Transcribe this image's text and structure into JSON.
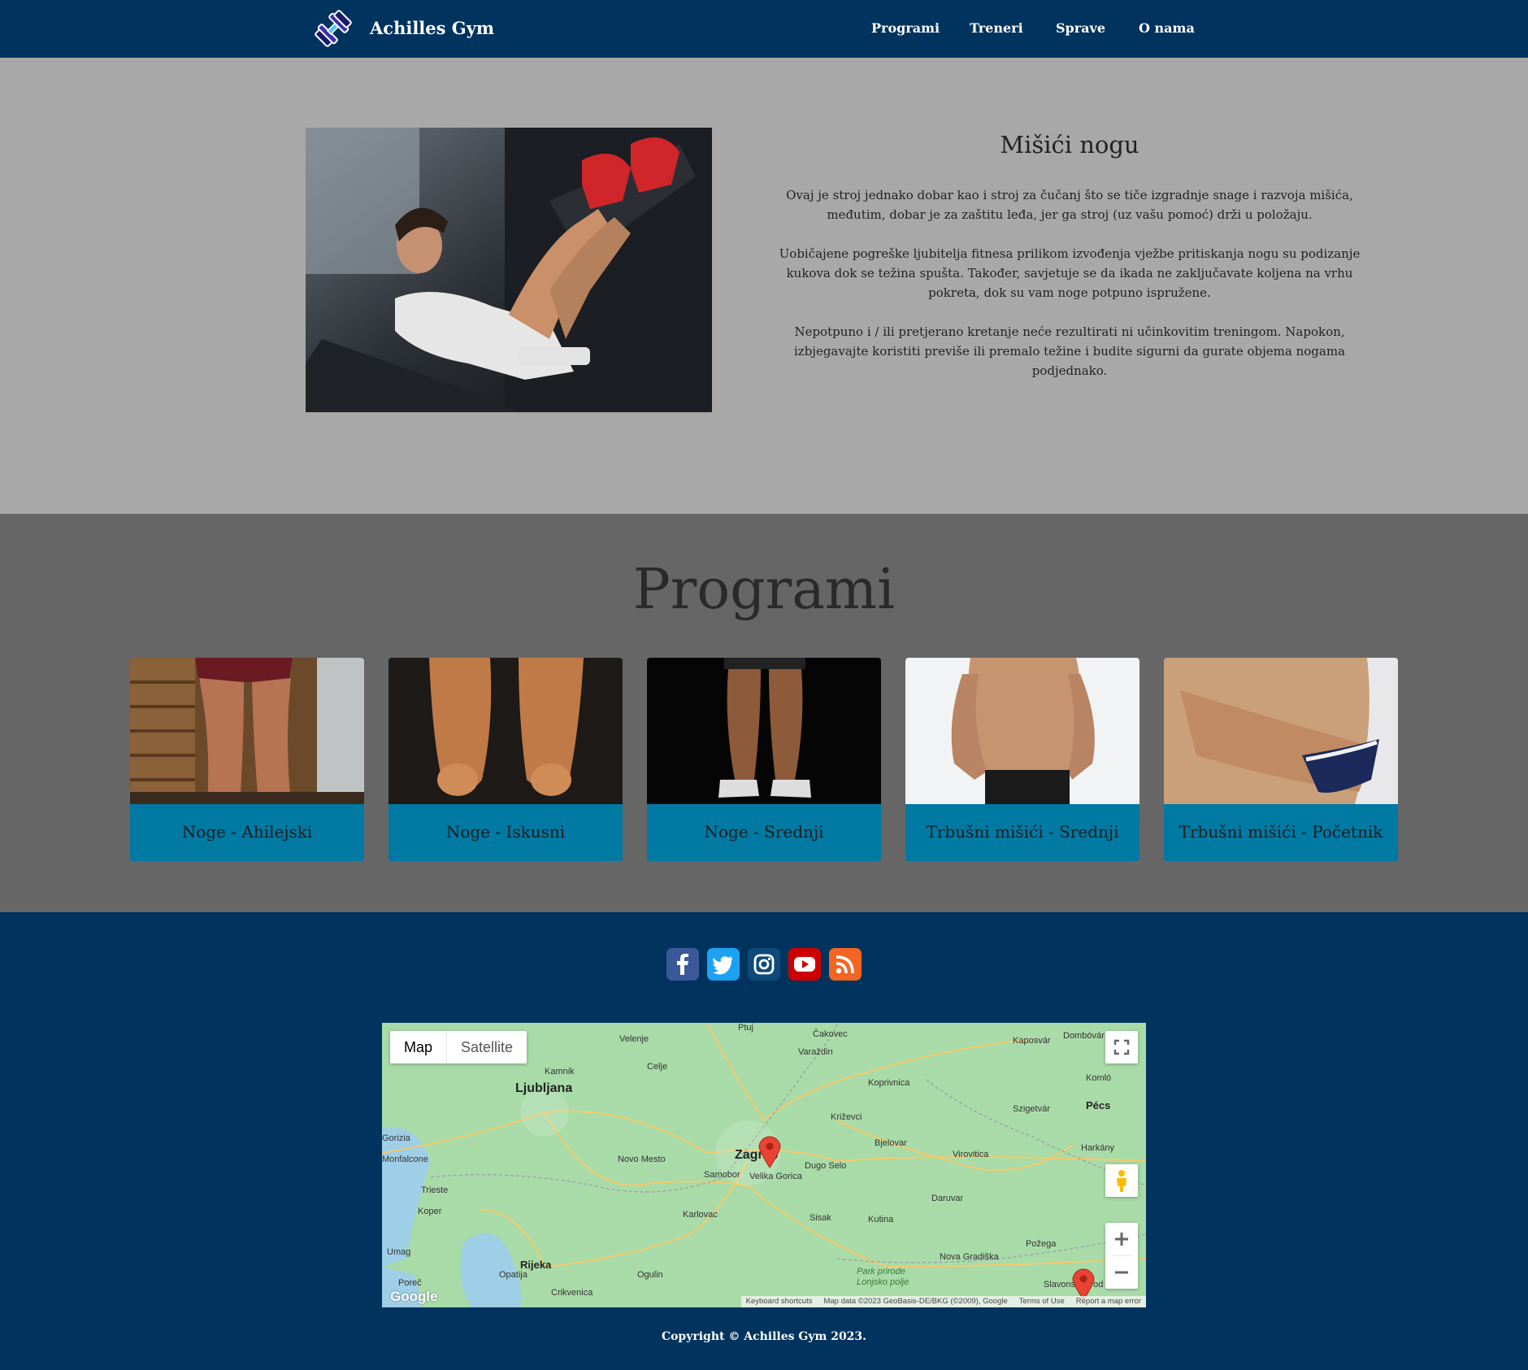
{
  "navbar": {
    "brand": "Achilles Gym",
    "links": [
      "Programi",
      "Treneri",
      "Sprave",
      "O nama"
    ]
  },
  "hero": {
    "title": "Mišići nogu",
    "paragraphs": [
      "Ovaj je stroj jednako dobar kao i stroj za čučanj što se tiče izgradnje snage i razvoja mišića, međutim, dobar je za zaštitu leđa, jer ga stroj (uz vašu pomoć) drži u položaju.",
      "Uobičajene pogreške ljubitelja fitnesa prilikom izvođenja vježbe pritiskanja nogu su podizanje kukova dok se težina spušta. Također, savjetuje se da ikada ne zaključavate koljena na vrhu pokreta, dok su vam noge potpuno ispružene.",
      "Nepotpuno i / ili pretjerano kretanje neće rezultirati ni učinkovitim treningom. Napokon, izbjegavajte koristiti previše ili premalo težine i budite sigurni da gurate objema nogama podjednako."
    ]
  },
  "programs": {
    "title": "Programi",
    "cards": [
      {
        "label": "Noge - Ahilejski"
      },
      {
        "label": "Noge - Iskusni"
      },
      {
        "label": "Noge - Srednji"
      },
      {
        "label": "Trbušni mišići - Srednji"
      },
      {
        "label": "Trbušni mišići - Početnik"
      }
    ]
  },
  "footer": {
    "social": [
      {
        "icon": "facebook-icon",
        "color": "#3b5998"
      },
      {
        "icon": "twitter-icon",
        "color": "#1da1f2"
      },
      {
        "icon": "instagram-icon",
        "color": "#0d4a7a"
      },
      {
        "icon": "youtube-icon",
        "color": "#cc0000"
      },
      {
        "icon": "rss-icon",
        "color": "#f26522"
      }
    ],
    "map": {
      "type_map": "Map",
      "type_satellite": "Satellite",
      "attribution": [
        "Keyboard shortcuts",
        "Map data ©2023 GeoBasis-DE/BKG (©2009), Google",
        "Terms of Use",
        "Report a map error"
      ],
      "logo": "Google",
      "labels": [
        "Ljubljana",
        "Zagreb",
        "Rijeka",
        "Trieste",
        "Koper",
        "Novo Mesto",
        "Samobor",
        "Velika Gorica",
        "Dugo Selo",
        "Karlovac",
        "Sisak",
        "Kutina",
        "Bjelovar",
        "Križevci",
        "Koprivnica",
        "Varaždin",
        "Čakovec",
        "Celje",
        "Kamnik",
        "Velenje",
        "Virovitica",
        "Daruvar",
        "Požega",
        "Nova Gradiška",
        "Pécs",
        "Kaposvár",
        "Dombóvár",
        "Komló",
        "Szigetvár",
        "Harkány",
        "Opatija",
        "Crikvenica",
        "Ogulin",
        "Umag",
        "Poreč",
        "Monfalcone",
        "Gorizia",
        "Ptuj",
        "Slavonski Brod",
        "Park prirode Lonjsko polje"
      ]
    },
    "copyright": "Copyright © Achilles Gym 2023."
  }
}
